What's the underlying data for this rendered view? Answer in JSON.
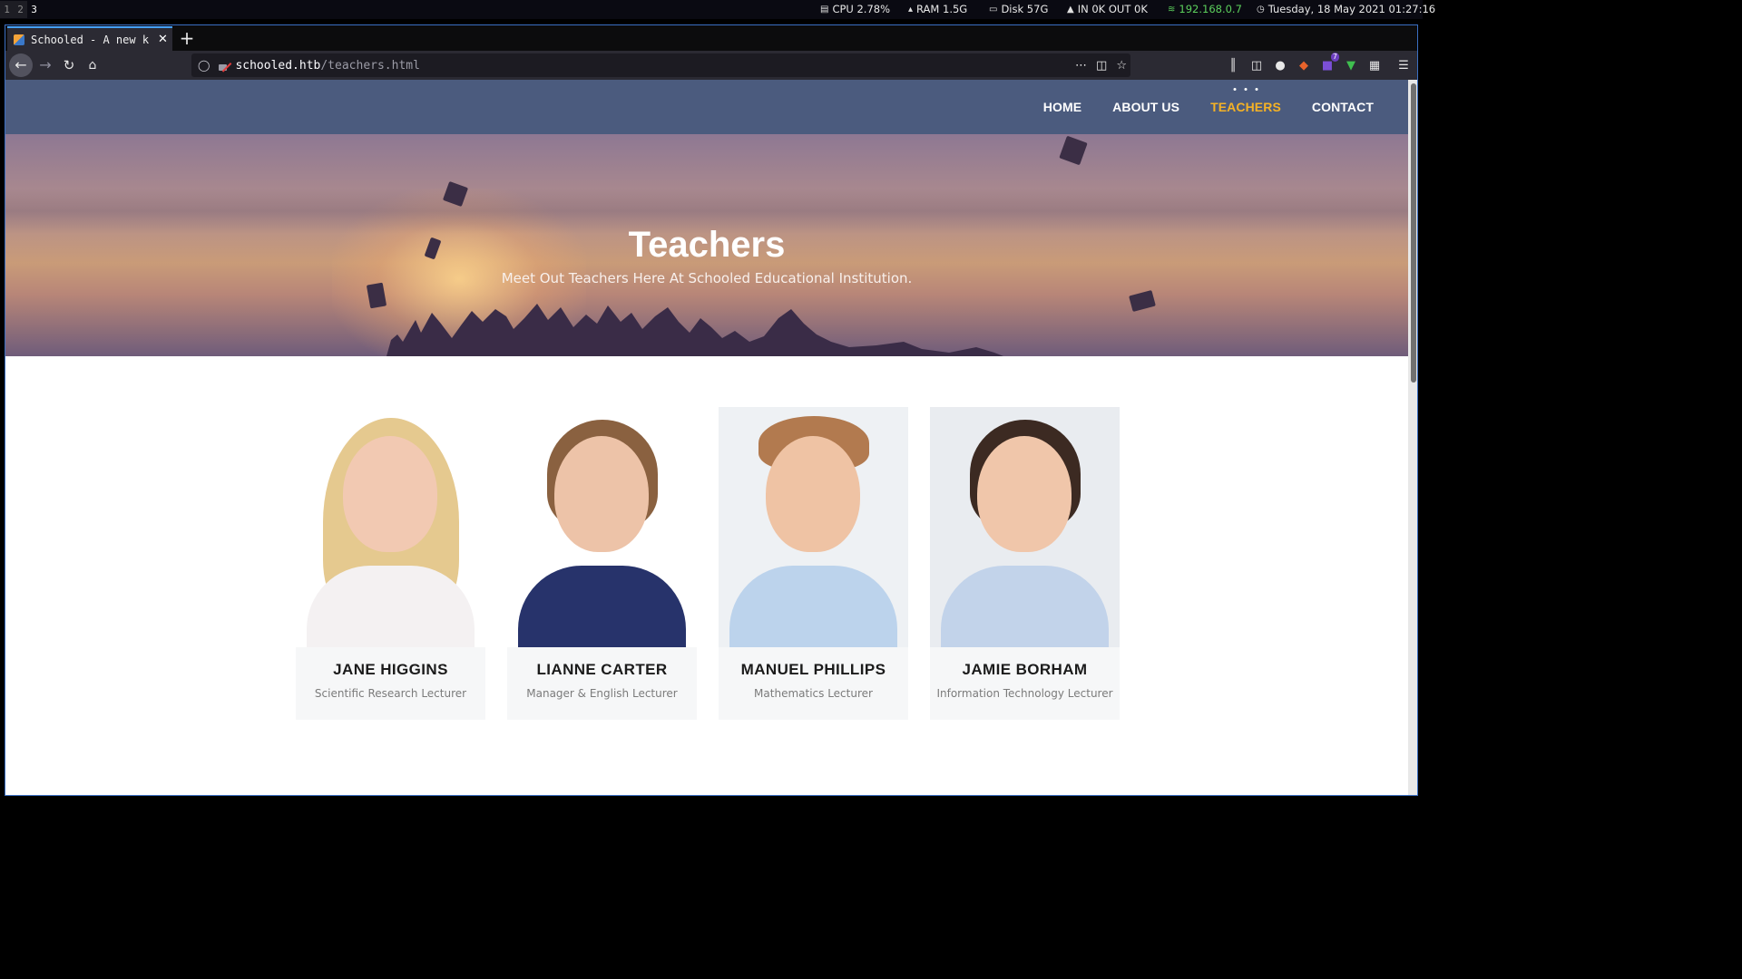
{
  "statusbar": {
    "workspaces": [
      "1",
      "2",
      "3"
    ],
    "cpu": "CPU 2.78%",
    "ram": "RAM 1.5G",
    "disk": "Disk 57G",
    "net": "IN 0K OUT 0K",
    "ip": "192.168.0.7",
    "datetime": "Tuesday, 18 May 2021 01:27:16",
    "colors": {
      "ip": "#5cd05c",
      "background": "#0a0a12"
    }
  },
  "browser": {
    "tab_title": "Schooled - A new k",
    "url_host": "schooled.htb",
    "url_path": "/teachers.html",
    "extension_badge": "7"
  },
  "site": {
    "nav": {
      "home": "HOME",
      "about": "ABOUT US",
      "teachers": "TEACHERS",
      "contact": "CONTACT",
      "active": "teachers"
    },
    "hero": {
      "title": "Teachers",
      "subtitle": "Meet Out Teachers Here At Schooled Educational Institution."
    },
    "teachers": [
      {
        "name": "JANE HIGGINS",
        "role": "Scientific Research Lecturer"
      },
      {
        "name": "LIANNE CARTER",
        "role": "Manager & English Lecturer"
      },
      {
        "name": "MANUEL PHILLIPS",
        "role": "Mathematics Lecturer"
      },
      {
        "name": "JAMIE BORHAM",
        "role": "Information Technology Lecturer"
      }
    ],
    "colors": {
      "header": "#4b5b7e",
      "nav_active": "#f5b225",
      "card_bg": "#f6f7f8"
    }
  }
}
